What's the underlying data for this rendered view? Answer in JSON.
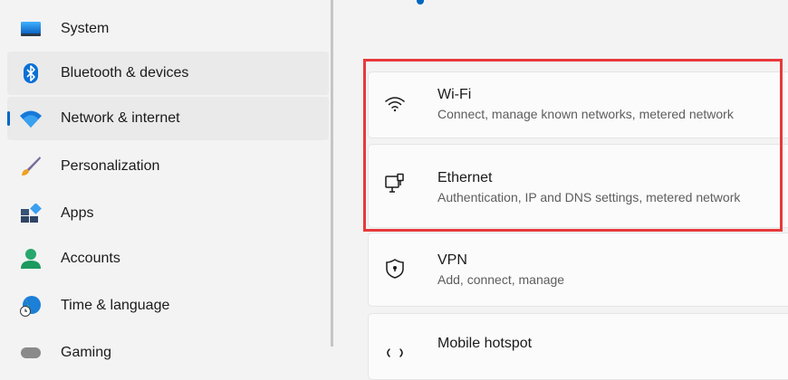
{
  "sidebar": {
    "items": [
      {
        "label": "System",
        "icon": "system-icon"
      },
      {
        "label": "Bluetooth & devices",
        "icon": "bluetooth-icon"
      },
      {
        "label": "Network & internet",
        "icon": "wifi-icon",
        "selected": true
      },
      {
        "label": "Personalization",
        "icon": "brush-icon"
      },
      {
        "label": "Apps",
        "icon": "apps-icon"
      },
      {
        "label": "Accounts",
        "icon": "person-icon"
      },
      {
        "label": "Time & language",
        "icon": "globe-clock-icon"
      },
      {
        "label": "Gaming",
        "icon": "gamepad-icon"
      }
    ]
  },
  "main": {
    "cards": [
      {
        "title": "Wi-Fi",
        "subtitle": "Connect, manage known networks, metered network",
        "icon": "wifi-icon"
      },
      {
        "title": "Ethernet",
        "subtitle": "Authentication, IP and DNS settings, metered network",
        "icon": "ethernet-icon"
      },
      {
        "title": "VPN",
        "subtitle": "Add, connect, manage",
        "icon": "shield-icon"
      },
      {
        "title": "Mobile hotspot",
        "subtitle": "",
        "icon": "hotspot-icon"
      }
    ]
  },
  "colors": {
    "accent": "#0067c0",
    "highlight": "#e8393b"
  }
}
